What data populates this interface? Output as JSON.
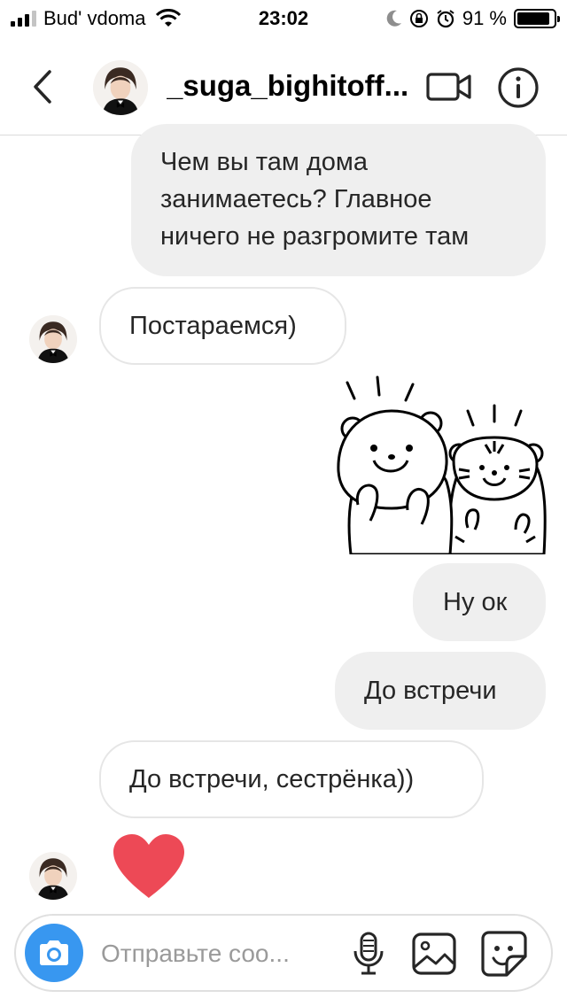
{
  "status_bar": {
    "carrier": "Bud' vdoma",
    "time": "23:02",
    "battery_percent_label": "91 %",
    "battery_level": 0.91,
    "signal_bars": 4,
    "signal_bars_active": 3,
    "icons": [
      "signal-icon",
      "wifi-icon",
      "moon-icon",
      "rotation-lock-icon",
      "alarm-icon",
      "battery-icon"
    ]
  },
  "header": {
    "back_icon": "chevron-left-icon",
    "username": "_suga_bighitoff...",
    "video_icon": "video-camera-icon",
    "info_icon": "info-icon"
  },
  "messages": [
    {
      "direction": "outgoing",
      "type": "text",
      "text": "Чем вы там дома\nзанимаетесь? Главное\nничего не разгромите там"
    },
    {
      "direction": "incoming",
      "type": "text",
      "text": "Постараемся)"
    },
    {
      "direction": "outgoing",
      "type": "sticker",
      "sticker": "bear-and-tiger-sticker"
    },
    {
      "direction": "outgoing",
      "type": "text",
      "text": "Ну ок"
    },
    {
      "direction": "outgoing",
      "type": "text",
      "text": "До встречи"
    },
    {
      "direction": "incoming",
      "type": "text",
      "text": "До встречи, сестрёнка))"
    },
    {
      "direction": "incoming",
      "type": "reaction",
      "reaction": "heart-icon"
    }
  ],
  "composer": {
    "placeholder": "Отправьте соо...",
    "value": "",
    "camera_icon": "camera-icon",
    "mic_icon": "microphone-icon",
    "gallery_icon": "gallery-icon",
    "sticker_icon": "sticker-icon"
  },
  "colors": {
    "accent_blue": "#3897f0",
    "outgoing_bubble": "#efefef",
    "incoming_border": "#e6e6e6",
    "heart": "#ed4956",
    "divider": "#dbdbdb"
  }
}
